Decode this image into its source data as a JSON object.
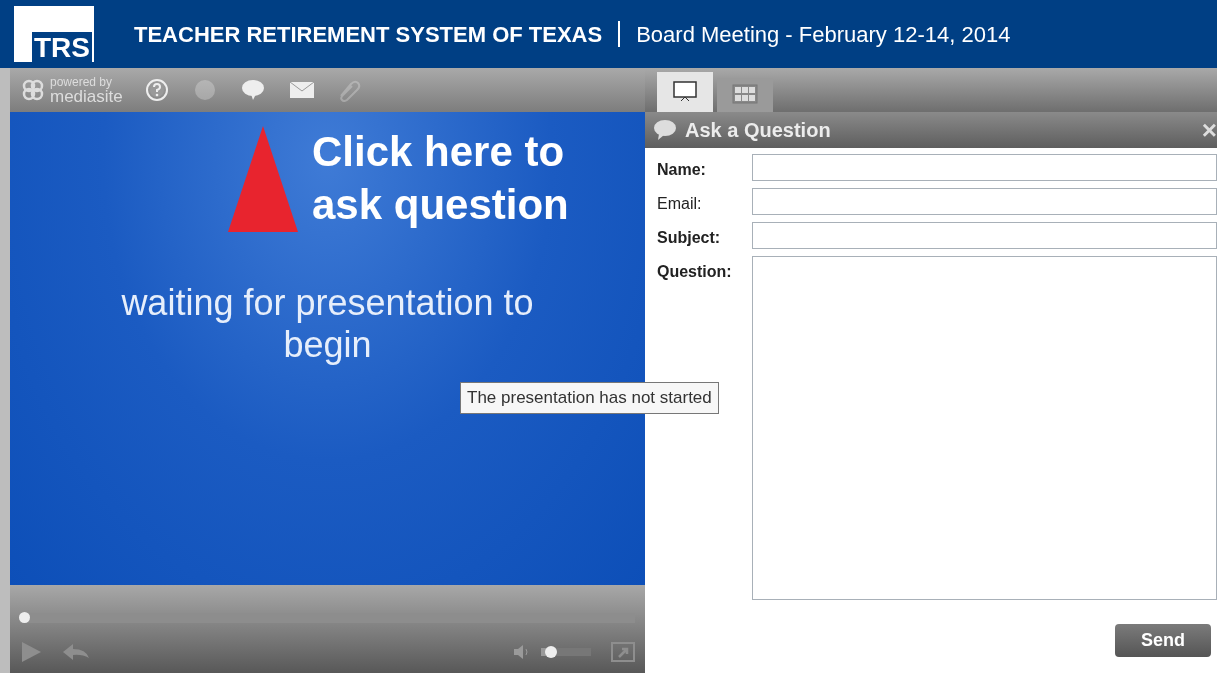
{
  "header": {
    "logo_text": "TRS",
    "organization": "TEACHER RETIREMENT SYSTEM OF TEXAS",
    "event": "Board Meeting - February 12-14, 2014"
  },
  "toolbar": {
    "powered_by": "powered by",
    "brand": "mediasite",
    "buttons": [
      {
        "kind": "help",
        "disabled": false
      },
      {
        "kind": "disc",
        "disabled": true
      },
      {
        "kind": "question",
        "disabled": false
      },
      {
        "kind": "email",
        "disabled": false
      },
      {
        "kind": "link",
        "disabled": true
      }
    ]
  },
  "slide": {
    "message": "waiting for presentation to begin"
  },
  "annotation": {
    "text": "Click here to ask question"
  },
  "tooltip": "The presentation has not started",
  "player": {
    "progress": {
      "level": 0
    },
    "volume": {
      "level": 0.1
    }
  },
  "view_tabs": [
    {
      "kind": "slide",
      "selected": true
    },
    {
      "kind": "grid",
      "selected": false
    }
  ],
  "dialog": {
    "title": "Ask a Question",
    "close": "×",
    "fields": [
      {
        "label": "Name:",
        "kind": "input",
        "required": true
      },
      {
        "label": "Email:",
        "kind": "input",
        "required": false
      },
      {
        "label": "Subject:",
        "kind": "input",
        "required": true
      },
      {
        "label": "Question:",
        "kind": "textarea",
        "required": true
      }
    ],
    "send": "Send"
  }
}
